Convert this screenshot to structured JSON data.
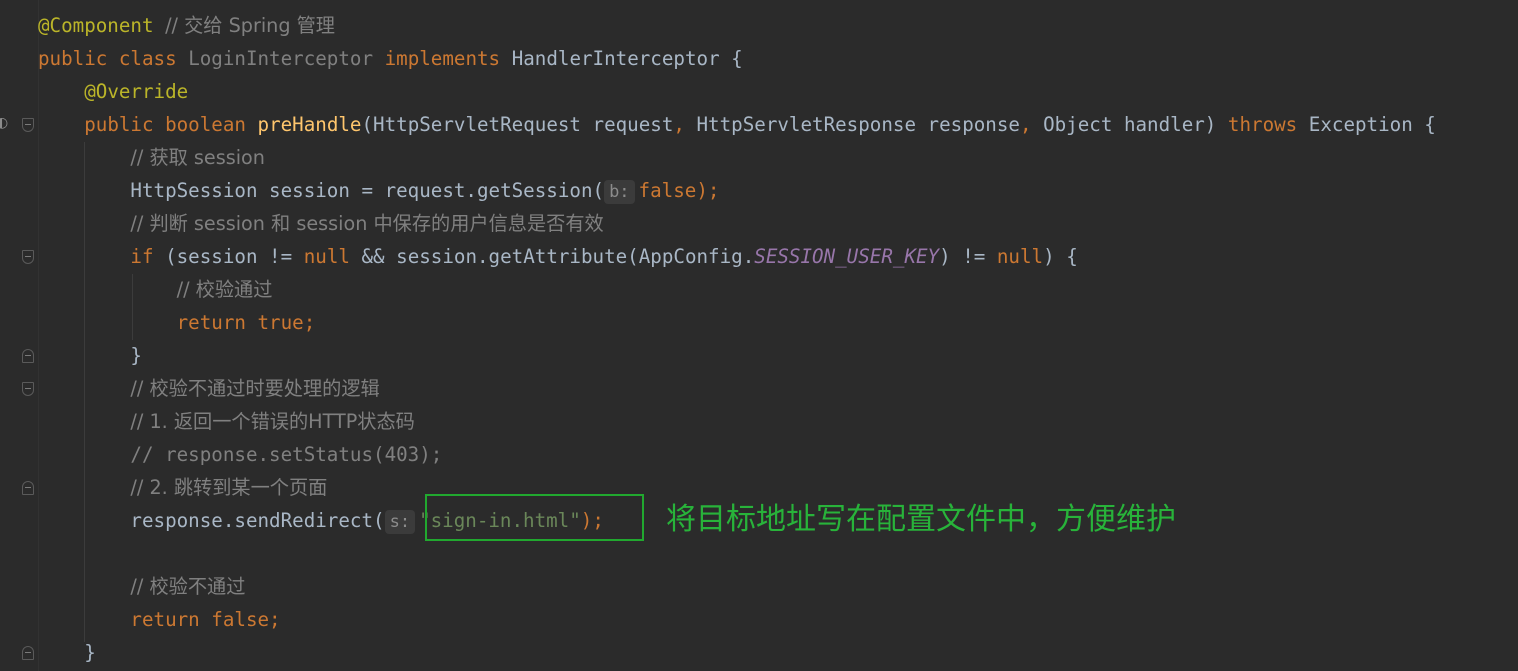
{
  "code": {
    "l1_annotation": "@Component",
    "l1_comment": "// 交给 Spring 管理",
    "l2_kw1": "public class",
    "l2_class": "LoginInterceptor",
    "l2_kw2": "implements",
    "l2_iface": "HandlerInterceptor {",
    "l3_annotation": "@Override",
    "l4_kw1": "public boolean",
    "l4_fn": "preHandle",
    "l4_p1": "(HttpServletRequest request",
    "l4_p2": " HttpServletResponse response",
    "l4_p3": " Object handler) ",
    "l4_throws": "throws",
    "l4_exc": " Exception {",
    "l5_comment": "// 获取 session",
    "l6_a": "HttpSession session = request.getSession(",
    "l6_hint": "b:",
    "l6_false": "false",
    "l6_end": ");",
    "l7_comment": "// 判断 session 和 session 中保存的用户信息是否有效",
    "l8_if": "if",
    "l8_a": " (session != ",
    "l8_null": "null",
    "l8_b": " && session.getAttribute(AppConfig.",
    "l8_field": "SESSION_USER_KEY",
    "l8_c": ") != ",
    "l8_null2": "null",
    "l8_d": ") {",
    "l9_comment": "// 校验通过",
    "l10_return": "return true;",
    "l11_brace": "}",
    "l12_comment": "// 校验不通过时要处理的逻辑",
    "l13_comment": "// 1. 返回一个错误的HTTP状态码",
    "l14_comment": "// response.setStatus(403);",
    "l15_comment": "// 2. 跳转到某一个页面",
    "l16_a": "response.sendRedirect(",
    "l16_hint": "s:",
    "l16_str": "\"sign-in.html\"",
    "l16_end": ");",
    "l18_comment": "// 校验不通过",
    "l19_return": "return false;",
    "l20_brace": "}"
  },
  "annotation_note": "将目标地址写在配置文件中，方便维护",
  "colors": {
    "background": "#2b2b2b",
    "keyword": "#cc7832",
    "annotation": "#bbb529",
    "function": "#ffc66d",
    "comment": "#808080",
    "string": "#6a8759",
    "field": "#9876aa",
    "highlight": "#21a82f"
  },
  "gutter_icons": [
    "implementation-marker-icon",
    "fold-icon"
  ]
}
